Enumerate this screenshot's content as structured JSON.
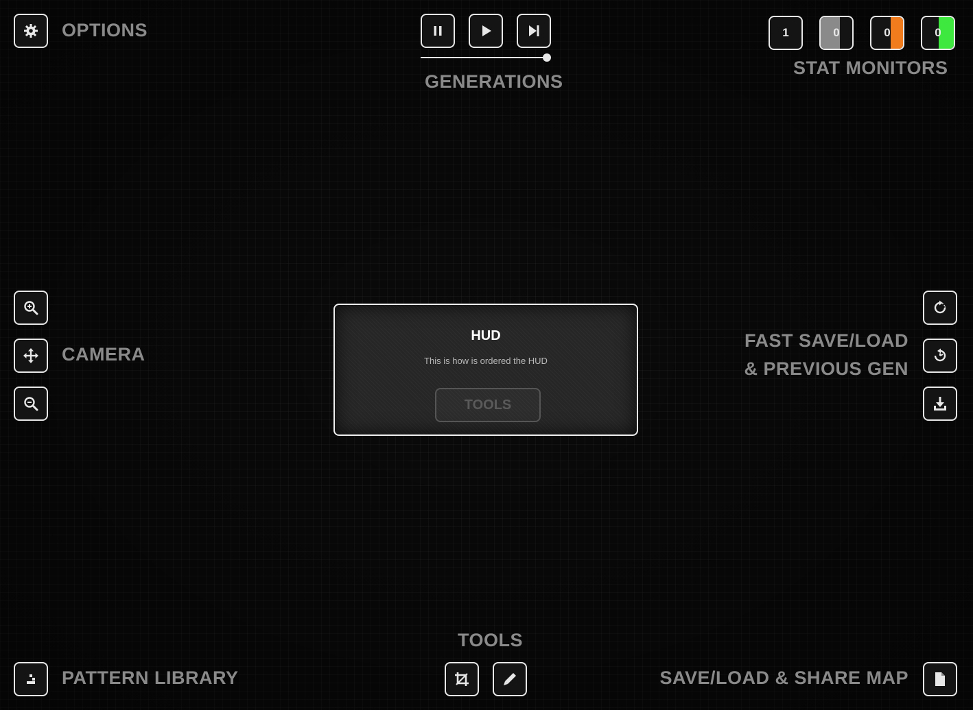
{
  "options": {
    "label": "OPTIONS",
    "icon": "gear-icon"
  },
  "generations": {
    "label": "GENERATIONS",
    "controls": [
      {
        "name": "pause",
        "icon": "pause-icon"
      },
      {
        "name": "play",
        "icon": "play-icon"
      },
      {
        "name": "step",
        "icon": "step-forward-icon"
      }
    ],
    "speed_slider_value": 1.0
  },
  "stat_monitors": {
    "label": "STAT MONITORS",
    "items": [
      {
        "value": "1",
        "color": "#141414"
      },
      {
        "value": "0",
        "color": "#8a8a8a"
      },
      {
        "value": "0",
        "color": "#f07c1e"
      },
      {
        "value": "0",
        "color": "#3ee83e"
      }
    ]
  },
  "camera": {
    "label": "CAMERA",
    "icons": [
      "zoom-in-icon",
      "move-icon",
      "zoom-out-icon"
    ]
  },
  "fast_save": {
    "label_line1": "FAST SAVE/LOAD",
    "label_line2": "& PREVIOUS GEN",
    "icons": [
      "fast-save-icon",
      "fast-load-icon",
      "previous-gen-icon"
    ]
  },
  "hud_modal": {
    "title": "HUD",
    "text": "This is how is ordered the HUD",
    "button_label": "TOOLS"
  },
  "tools": {
    "label": "TOOLS",
    "icons": [
      "crop-icon",
      "pencil-icon"
    ]
  },
  "pattern_library": {
    "label": "PATTERN LIBRARY",
    "icon": "pattern-icon"
  },
  "save_share": {
    "label": "SAVE/LOAD & SHARE MAP",
    "icon": "document-icon"
  },
  "colors": {
    "border": "#e8e8e8",
    "label": "#8a8a8a",
    "background": "#0a0a0a",
    "orange": "#f07c1e",
    "green": "#3ee83e"
  }
}
